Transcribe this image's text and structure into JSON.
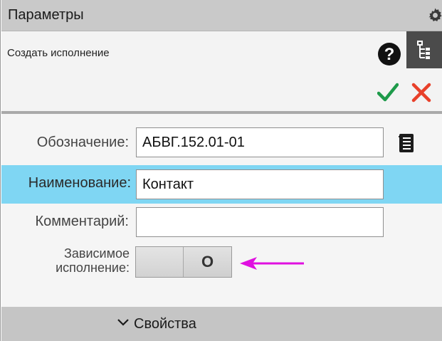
{
  "panel": {
    "title": "Параметры",
    "command": "Создать исполнение"
  },
  "icons": {
    "settings": "gear-icon",
    "help": "help-icon",
    "tree": "tree-view-icon",
    "ok": "checkmark-icon",
    "cancel": "close-icon",
    "list": "list-icon",
    "expand": "chevron-down-icon"
  },
  "form": {
    "designation_label": "Обозначение:",
    "designation_value": "АБВГ.152.01-01",
    "name_label": "Наименование:",
    "name_value": "Контакт",
    "comment_label": "Комментарий:",
    "comment_value": "",
    "dependent_label_1": "Зависимое",
    "dependent_label_2": "исполнение:",
    "dependent_toggle_text": "O"
  },
  "footer": {
    "properties_label": "Свойства"
  },
  "colors": {
    "highlight": "#7fd6f3",
    "ok": "#1e9a4a",
    "cancel": "#e8402a",
    "annotation_arrow": "#e010e0"
  }
}
